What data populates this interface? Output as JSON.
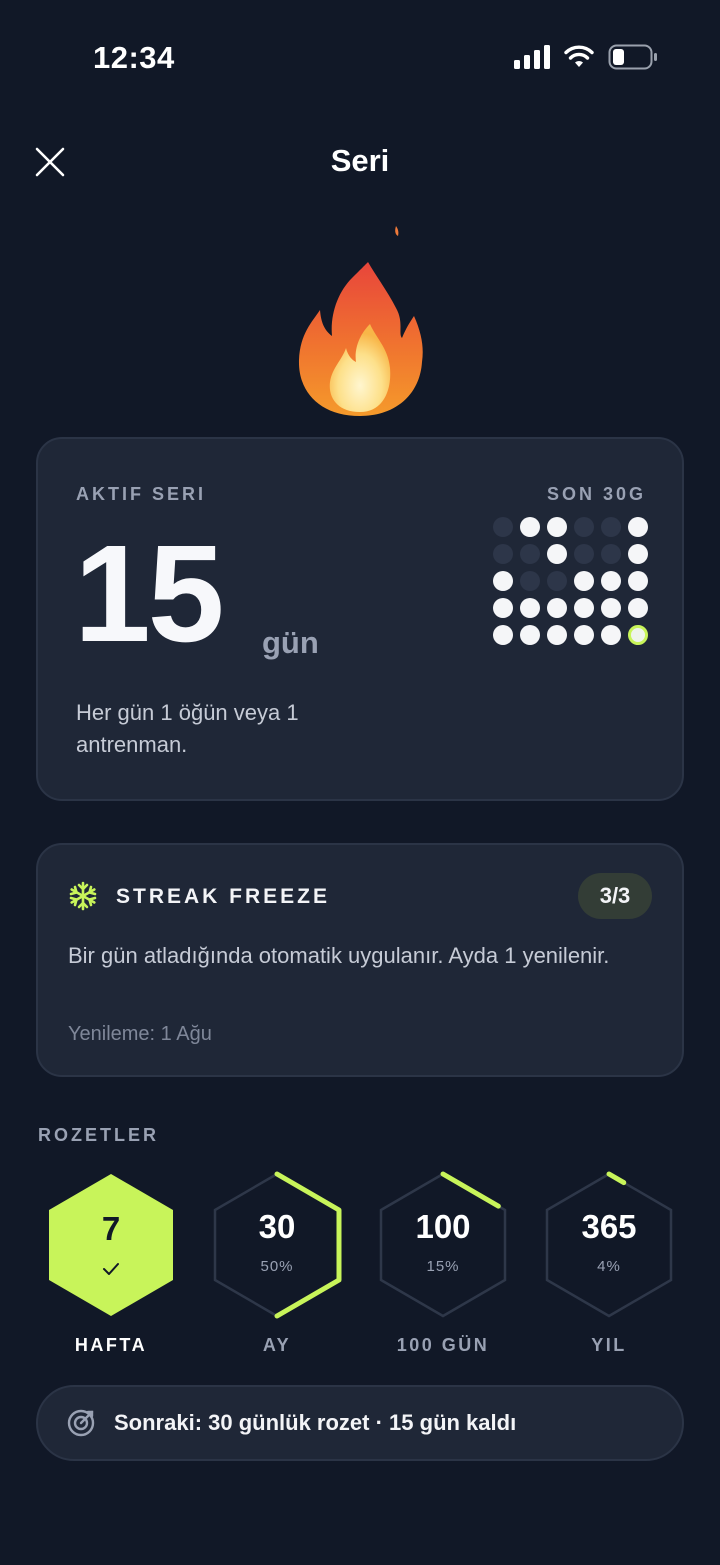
{
  "status_bar": {
    "time": "12:34"
  },
  "header": {
    "title": "Seri"
  },
  "streak": {
    "label": "AKTIF SERI",
    "count": "15",
    "unit": "gün",
    "description": "Her gün 1 öğün veya 1 antrenman.",
    "grid_label": "SON 30G",
    "last_30_days": [
      0,
      1,
      1,
      0,
      0,
      1,
      0,
      0,
      1,
      0,
      0,
      1,
      1,
      0,
      0,
      1,
      1,
      1,
      1,
      1,
      1,
      1,
      1,
      1,
      1,
      1,
      1,
      1,
      1,
      2
    ]
  },
  "freeze": {
    "title": "STREAK FREEZE",
    "count": "3/3",
    "description": "Bir gün atladığında otomatik uygulanır. Ayda 1 yenilenir.",
    "renewal": "Yenileme: 1 Ağu"
  },
  "badges": {
    "label": "ROZETLER",
    "items": [
      {
        "value": "7",
        "name": "HAFTA",
        "completed": true,
        "progress": 1.0
      },
      {
        "value": "30",
        "percent": "50%",
        "name": "AY",
        "completed": false,
        "progress": 0.5
      },
      {
        "value": "100",
        "percent": "15%",
        "name": "100 GÜN",
        "completed": false,
        "progress": 0.15
      },
      {
        "value": "365",
        "percent": "4%",
        "name": "YIL",
        "completed": false,
        "progress": 0.04
      }
    ]
  },
  "next_badge": {
    "text": "Sonraki: 30 günlük rozet · 15 gün kaldı"
  },
  "colors": {
    "background": "#111827",
    "card": "#1f2737",
    "accent_lime": "#c8f45a",
    "muted_text": "#99a1b3"
  }
}
